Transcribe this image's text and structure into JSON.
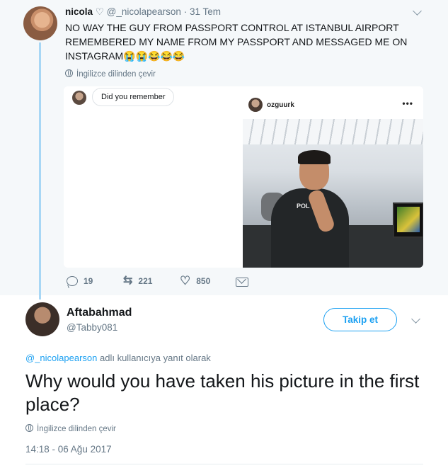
{
  "parent_tweet": {
    "name": "nicola",
    "heart_symbol": "♡",
    "handle": "@_nicolapearson",
    "separator": "·",
    "time": "31 Tem",
    "text": "NO WAY THE GUY FROM PASSPORT CONTROL AT ISTANBUL AIRPORT REMEMBERED MY NAME FROM MY PASSPORT AND MESSAGED ME ON INSTAGRAM😭😭😂😂😂",
    "translate_label": "İngilizce dilinden çevir",
    "media": {
      "dm_message": "Did you remember",
      "instagram_username": "ozguurk",
      "instagram_more": "•••",
      "vest_text": "POL"
    },
    "actions": {
      "replies": "19",
      "retweets": "221",
      "likes": "850"
    }
  },
  "reply_tweet": {
    "name": "Aftabahmad",
    "handle": "@Tabby081",
    "follow_label": "Takip et",
    "replying_mention": "@_nicolapearson",
    "replying_suffix": "adlı kullanıcıya yanıt olarak",
    "text": "Why would you have taken his picture in the first place?",
    "translate_label": "İngilizce dilinden çevir",
    "timestamp": "14:18 - 06 Ağu 2017"
  },
  "colors": {
    "accent": "#1da1f2",
    "thread_line": "#a8d7f5",
    "muted_text": "#657786",
    "parent_background": "#f5f8fa"
  },
  "icons": [
    "heart-outline-icon",
    "chevron-down-icon",
    "globe-icon",
    "reply-icon",
    "retweet-icon",
    "like-icon",
    "direct-message-icon"
  ]
}
